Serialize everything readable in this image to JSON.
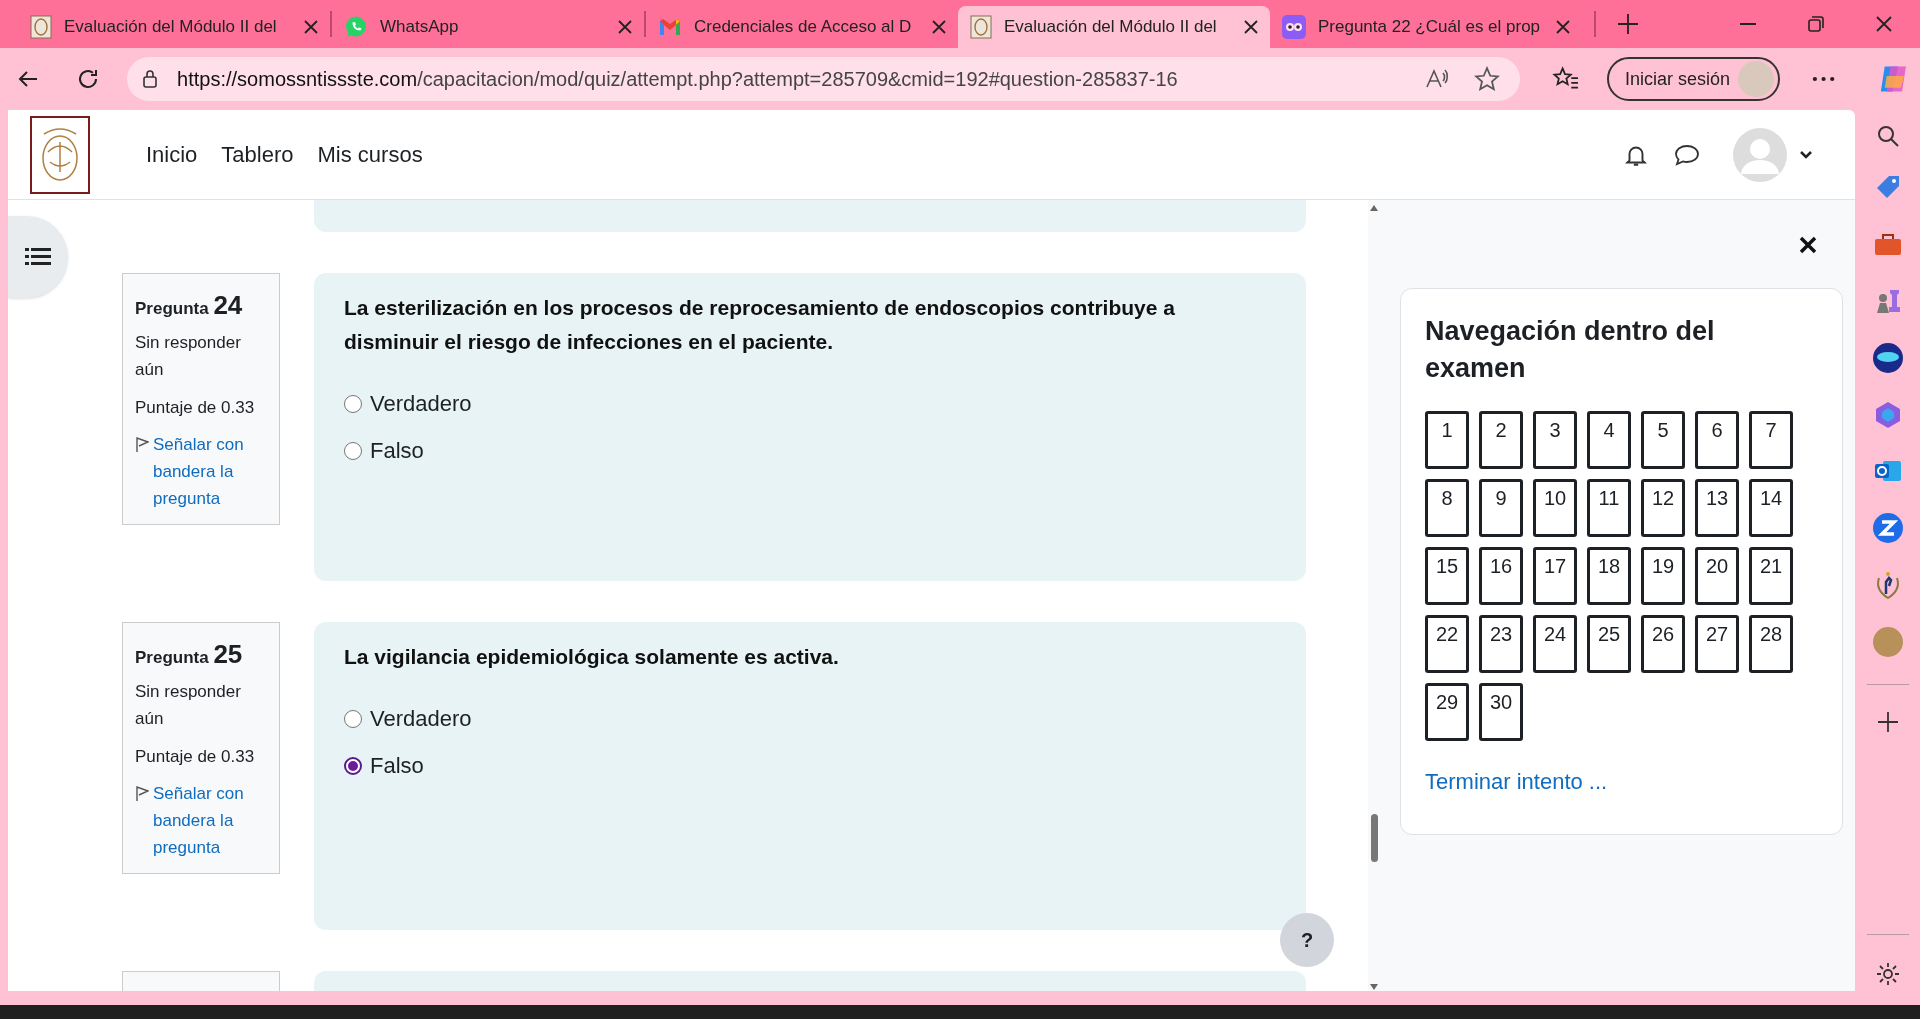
{
  "browser": {
    "tabs": [
      {
        "title": "Evaluación del Módulo II del",
        "kind": "logo",
        "selected": false
      },
      {
        "title": "WhatsApp",
        "kind": "whatsapp",
        "selected": false
      },
      {
        "title": "Credenciales de Acceso al D",
        "kind": "gmail",
        "selected": false
      },
      {
        "title": "Evaluación del Módulo II del",
        "kind": "logo",
        "selected": true
      },
      {
        "title": "Pregunta 22 ¿Cuál es el prop",
        "kind": "owl",
        "selected": false
      }
    ],
    "url_host": "https://somossntissste.com",
    "url_path": "/capacitacion/mod/quiz/attempt.php?attempt=285709&cmid=192#question-285837-16",
    "sign_in": "Iniciar sesión"
  },
  "header": {
    "nav": [
      "Inicio",
      "Tablero",
      "Mis cursos"
    ]
  },
  "questions": [
    {
      "label": "Pregunta",
      "number": "24",
      "status": "Sin responder aún",
      "score": "Puntaje de 0.33",
      "flag": "Señalar con bandera la pregunta",
      "text": "La esterilización en los procesos de reprocesamiento de endoscopios contribuye a disminuir el riesgo de infecciones en el paciente.",
      "options": [
        {
          "label": "Verdadero",
          "selected": false
        },
        {
          "label": "Falso",
          "selected": false
        }
      ]
    },
    {
      "label": "Pregunta",
      "number": "25",
      "status": "Sin responder aún",
      "score": "Puntaje de 0.33",
      "flag": "Señalar con bandera la pregunta",
      "text": "La vigilancia epidemiológica solamente es activa.",
      "options": [
        {
          "label": "Verdadero",
          "selected": false
        },
        {
          "label": "Falso",
          "selected": true
        }
      ]
    }
  ],
  "help_button": "?",
  "quiz_navigation": {
    "title": "Navegación dentro del examen",
    "buttons": [
      "1",
      "2",
      "3",
      "4",
      "5",
      "6",
      "7",
      "8",
      "9",
      "10",
      "11",
      "12",
      "13",
      "14",
      "15",
      "16",
      "17",
      "18",
      "19",
      "20",
      "21",
      "22",
      "23",
      "24",
      "25",
      "26",
      "27",
      "28",
      "29",
      "30"
    ],
    "finish": "Terminar intento ..."
  }
}
